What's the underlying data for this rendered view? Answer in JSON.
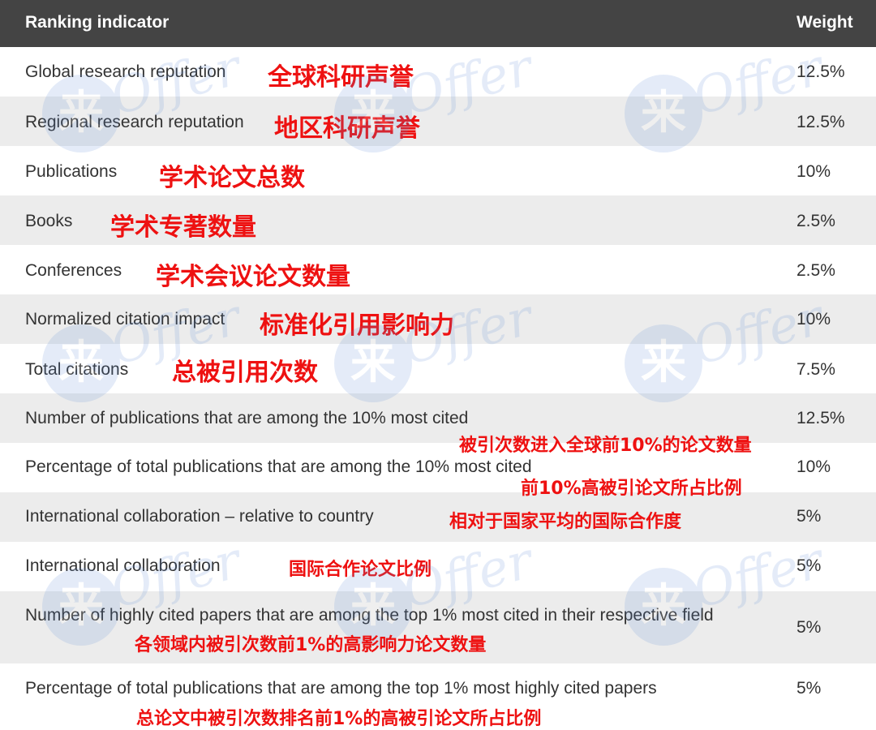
{
  "header": {
    "indicator_label": "Ranking indicator",
    "weight_label": "Weight"
  },
  "watermark": {
    "mark": "来",
    "word": "Offer",
    "color": "#5b8bd8"
  },
  "colors": {
    "header_bg": "#444444",
    "row_alt_bg": "#ececec",
    "annotation": "#ee1111"
  },
  "rows": [
    {
      "indicator": "Global research reputation",
      "annotation": "全球科研声誉",
      "weight": "12.5%"
    },
    {
      "indicator": "Regional research reputation",
      "annotation": "地区科研声誉",
      "weight": "12.5%"
    },
    {
      "indicator": "Publications",
      "annotation": "学术论文总数",
      "weight": "10%"
    },
    {
      "indicator": "Books",
      "annotation": "学术专著数量",
      "weight": "2.5%"
    },
    {
      "indicator": "Conferences",
      "annotation": "学术会议论文数量",
      "weight": "2.5%"
    },
    {
      "indicator": "Normalized citation impact",
      "annotation": "标准化引用影响力",
      "weight": "10%"
    },
    {
      "indicator": "Total citations",
      "annotation": "总被引用次数",
      "weight": "7.5%"
    },
    {
      "indicator": "Number of publications that are among the 10% most cited",
      "annotation": "被引次数进入全球前10%的论文数量",
      "weight": "12.5%"
    },
    {
      "indicator": "Percentage of total publications that are among the 10% most cited",
      "annotation": "前10%高被引论文所占比例",
      "weight": "10%"
    },
    {
      "indicator": "International collaboration – relative to country",
      "annotation": "相对于国家平均的国际合作度",
      "weight": "5%"
    },
    {
      "indicator": "International collaboration",
      "annotation": "国际合作论文比例",
      "weight": "5%"
    },
    {
      "indicator": "Number of highly cited papers that are among the top 1% most cited in their respective field",
      "annotation": "各领域内被引次数前1%的高影响力论文数量",
      "weight": "5%"
    },
    {
      "indicator": "Percentage of total publications that are among the top 1% most highly cited papers",
      "annotation": "总论文中被引次数排名前1%的高被引论文所占比例",
      "weight": "5%"
    }
  ]
}
